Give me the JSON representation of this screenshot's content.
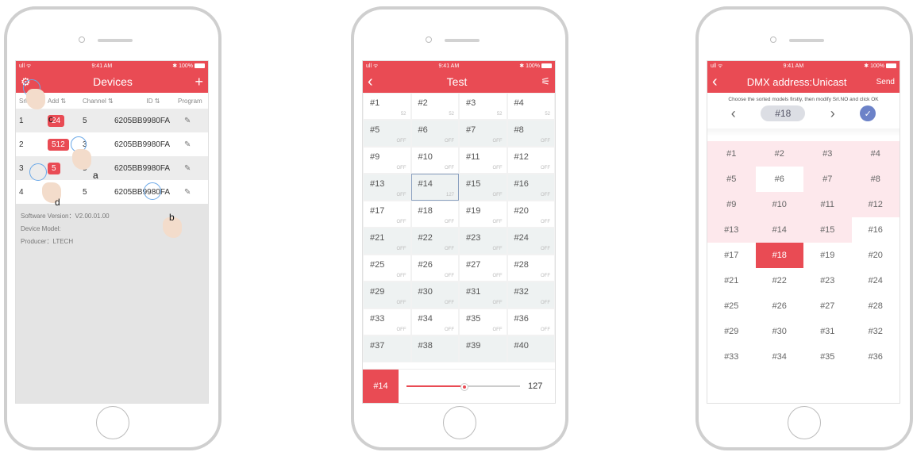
{
  "status": {
    "carrier": "ull ᯤ",
    "time": "9:41 AM",
    "battery": "✱ 100%"
  },
  "phone1": {
    "title": "Devices",
    "settings_icon": "gear-icon",
    "add_icon": "plus-icon",
    "add_label": "+",
    "columns": {
      "srl": "Srl",
      "add": "Add ⇅",
      "channel": "Channel ⇅",
      "id": "ID ⇅",
      "program": "Program"
    },
    "rows": [
      {
        "no": "1",
        "addr": "24",
        "channel": "5",
        "id": "6205BB9980FA"
      },
      {
        "no": "2",
        "addr": "512",
        "channel": "3",
        "id": "6205BB9980FA"
      },
      {
        "no": "3",
        "addr": "5",
        "channel": "5",
        "id": "6205BB9980FA"
      },
      {
        "no": "4",
        "addr": "2",
        "channel": "5",
        "id": "6205BB9980FA"
      }
    ],
    "edit_icon": "✎",
    "software": "Software Version：V2.00.01.00",
    "model": "Device Model:",
    "producer": "Producer：LTECH",
    "callouts": {
      "a": "a",
      "b": "b",
      "c": "c",
      "d": "d"
    }
  },
  "phone2": {
    "title": "Test",
    "back": "‹",
    "menu_icon": "sliders-icon",
    "menu_glyph": "⚟",
    "cells": [
      {
        "n": "#1",
        "v": "52"
      },
      {
        "n": "#2",
        "v": "52"
      },
      {
        "n": "#3",
        "v": "52"
      },
      {
        "n": "#4",
        "v": "52"
      },
      {
        "n": "#5",
        "v": "OFF"
      },
      {
        "n": "#6",
        "v": "OFF"
      },
      {
        "n": "#7",
        "v": "OFF"
      },
      {
        "n": "#8",
        "v": "OFF"
      },
      {
        "n": "#9",
        "v": "OFF"
      },
      {
        "n": "#10",
        "v": "OFF"
      },
      {
        "n": "#11",
        "v": "OFF"
      },
      {
        "n": "#12",
        "v": "OFF"
      },
      {
        "n": "#13",
        "v": "OFF"
      },
      {
        "n": "#14",
        "v": "127"
      },
      {
        "n": "#15",
        "v": "OFF"
      },
      {
        "n": "#16",
        "v": "OFF"
      },
      {
        "n": "#17",
        "v": "OFF"
      },
      {
        "n": "#18",
        "v": "OFF"
      },
      {
        "n": "#19",
        "v": "OFF"
      },
      {
        "n": "#20",
        "v": "OFF"
      },
      {
        "n": "#21",
        "v": "OFF"
      },
      {
        "n": "#22",
        "v": "OFF"
      },
      {
        "n": "#23",
        "v": "OFF"
      },
      {
        "n": "#24",
        "v": "OFF"
      },
      {
        "n": "#25",
        "v": "OFF"
      },
      {
        "n": "#26",
        "v": "OFF"
      },
      {
        "n": "#27",
        "v": "OFF"
      },
      {
        "n": "#28",
        "v": "OFF"
      },
      {
        "n": "#29",
        "v": "OFF"
      },
      {
        "n": "#30",
        "v": "OFF"
      },
      {
        "n": "#31",
        "v": "OFF"
      },
      {
        "n": "#32",
        "v": "OFF"
      },
      {
        "n": "#33",
        "v": "OFF"
      },
      {
        "n": "#34",
        "v": "OFF"
      },
      {
        "n": "#35",
        "v": "OFF"
      },
      {
        "n": "#36",
        "v": "OFF"
      },
      {
        "n": "#37",
        "v": ""
      },
      {
        "n": "#38",
        "v": ""
      },
      {
        "n": "#39",
        "v": ""
      },
      {
        "n": "#40",
        "v": ""
      }
    ],
    "selected": "#14",
    "slider_value": "127",
    "slider_fraction": 0.5
  },
  "phone3": {
    "title": "DMX address:Unicast",
    "back": "‹",
    "send": "Send",
    "hint": "Choose the sorted models firstly, then modify Srl.NO and click OK",
    "prev": "‹",
    "next": "›",
    "current": "#18",
    "ok_glyph": "✓",
    "cells": [
      "#1",
      "#2",
      "#3",
      "#4",
      "#5",
      "#6",
      "#7",
      "#8",
      "#9",
      "#10",
      "#11",
      "#12",
      "#13",
      "#14",
      "#15",
      "#16",
      "#17",
      "#18",
      "#19",
      "#20",
      "#21",
      "#22",
      "#23",
      "#24",
      "#25",
      "#26",
      "#27",
      "#28",
      "#29",
      "#30",
      "#31",
      "#32",
      "#33",
      "#34",
      "#35",
      "#36"
    ],
    "pink_cells": [
      "#1",
      "#2",
      "#3",
      "#4",
      "#5",
      "#7",
      "#8",
      "#9",
      "#10",
      "#11",
      "#12",
      "#13",
      "#14",
      "#15"
    ],
    "selected_cell": "#18"
  },
  "colors": {
    "accent": "#e94b54",
    "pink": "#fde8ec",
    "check": "#6c82c8"
  }
}
